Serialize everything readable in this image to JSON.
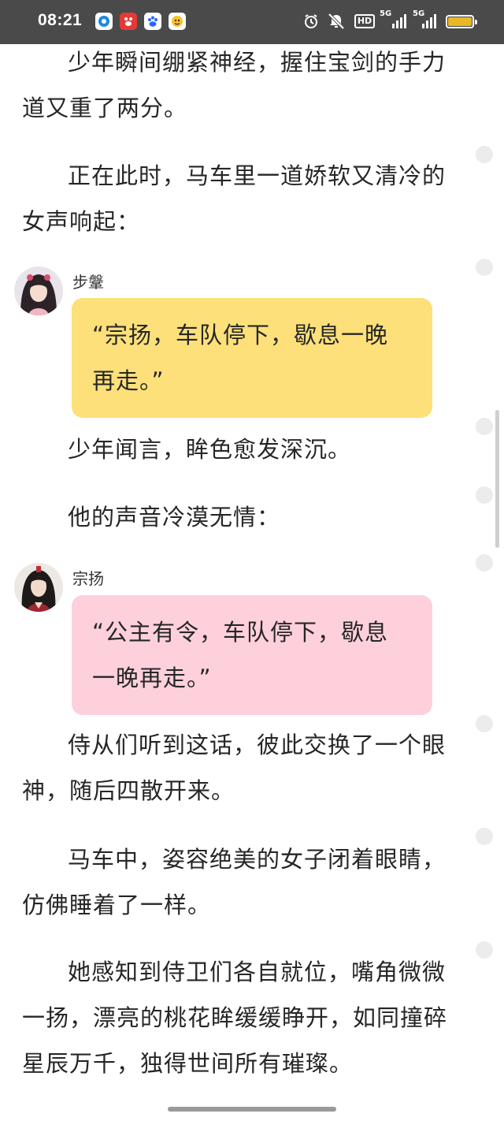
{
  "status_bar": {
    "time": "08:21",
    "hd_label": "HD",
    "signal_1_label": "5G",
    "signal_2_label": "5G",
    "app_icons": [
      "browser-icon",
      "baidu-app-icon",
      "baidu-icon",
      "pet-app-icon"
    ],
    "colors": {
      "background": "#4a4a4a",
      "battery_fill": "#e8b825"
    },
    "battery_level": 1.0
  },
  "story": {
    "paragraphs": [
      "少年瞬间绷紧神经，握住宝剑的手力道又重了两分。",
      "正在此时，马车里一道娇软又清冷的女声响起：",
      "少年闻言，眸色愈发深沉。",
      "他的声音冷漠无情：",
      "侍从们听到这话，彼此交换了一个眼神，随后四散开来。",
      "马车中，姿容绝美的女子闭着眼睛，仿佛睡着了一样。",
      "她感知到侍卫们各自就位，嘴角微微一扬，漂亮的桃花眸缓缓睁开，如同撞碎星辰万千，独得世间所有璀璨。"
    ],
    "dialogues": [
      {
        "speaker": "步鞶",
        "text": "“宗扬，车队停下，歇息一晚再走。”",
        "bubble_color": "#fde07a"
      },
      {
        "speaker": "宗扬",
        "text": "“公主有令，车队停下，歇息一晚再走。”",
        "bubble_color": "#fdd0dc"
      }
    ]
  }
}
